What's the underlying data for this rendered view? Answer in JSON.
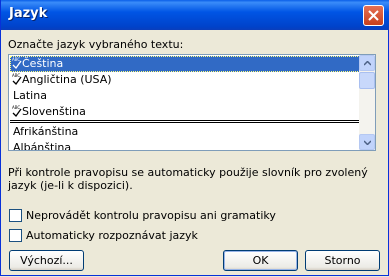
{
  "window": {
    "title": "Jazyk"
  },
  "prompt_label": "Označte jazyk vybraného textu:",
  "languages": {
    "recent": [
      {
        "label": "Čeština",
        "spellcheck": true,
        "selected": true
      },
      {
        "label": "Angličtina (USA)",
        "spellcheck": true,
        "selected": false
      },
      {
        "label": "Latina",
        "spellcheck": false,
        "selected": false
      },
      {
        "label": "Slovenština",
        "spellcheck": true,
        "selected": false
      }
    ],
    "all": [
      {
        "label": "Afrikánština"
      },
      {
        "label": "Albánština"
      }
    ]
  },
  "info_text": "Při kontrole pravopisu se automaticky použije slovník pro zvolený jazyk (je-li k dispozici).",
  "options": {
    "no_proofing": {
      "label": "Neprovádět kontrolu pravopisu ani gramatiky",
      "checked": false
    },
    "auto_detect": {
      "label": "Automaticky rozpoznávat jazyk",
      "checked": false
    }
  },
  "buttons": {
    "default": "Výchozí...",
    "ok": "OK",
    "cancel": "Storno"
  },
  "colors": {
    "title_bar": "#0055e5",
    "selection": "#316ac5",
    "dialog_bg": "#ece9d8"
  }
}
